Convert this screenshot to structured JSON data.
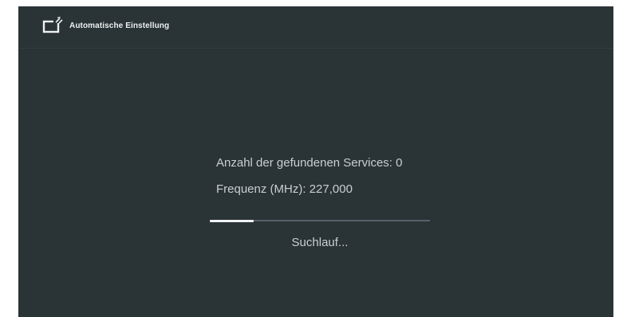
{
  "header": {
    "title": "Automatische Einstellung",
    "icon": "tv-antenna-icon"
  },
  "scan": {
    "services_label": "Anzahl der gefundenen Services:",
    "services_count": "0",
    "frequency_label": "Frequenz (MHz):",
    "frequency_value": "227,000",
    "progress_fraction": 0.2,
    "status_text": "Suchlauf..."
  },
  "colors": {
    "background": "#2a3336",
    "text": "#c9cfd1",
    "progress_fill": "#eef1f2",
    "progress_track": "#56626a"
  }
}
